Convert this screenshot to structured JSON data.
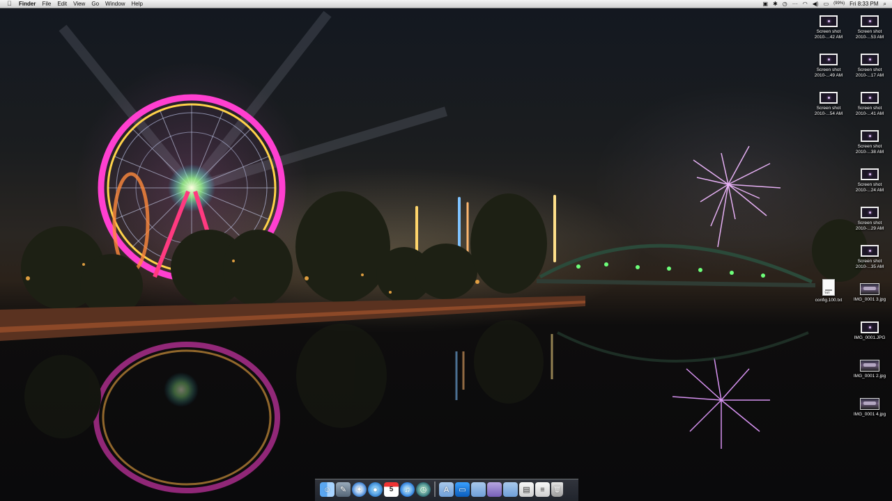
{
  "menubar": {
    "apple": "",
    "app_name": "Finder",
    "menus": [
      "File",
      "Edit",
      "View",
      "Go",
      "Window",
      "Help"
    ],
    "battery_percent": "(99%)",
    "clock": "Fri 8:33 PM",
    "icons": [
      "airplay-icon",
      "bluetooth-icon",
      "time-machine-icon",
      "dots-icon",
      "wifi-icon",
      "volume-icon",
      "battery-icon",
      "spotlight-icon"
    ]
  },
  "desktop": {
    "right_column": [
      {
        "label": "Screen shot",
        "sub": "2010-...53 AM",
        "type": "screenshot"
      },
      {
        "label": "Screen shot",
        "sub": "2010-...17 AM",
        "type": "screenshot"
      },
      {
        "label": "Screen shot",
        "sub": "2010-...41 AM",
        "type": "screenshot"
      },
      {
        "label": "Screen shot",
        "sub": "2010-...38 AM",
        "type": "screenshot"
      },
      {
        "label": "Screen shot",
        "sub": "2010-...24 AM",
        "type": "screenshot"
      },
      {
        "label": "Screen shot",
        "sub": "2010-...29 AM",
        "type": "screenshot"
      },
      {
        "label": "Screen shot",
        "sub": "2010-...35 AM",
        "type": "screenshot"
      },
      {
        "label": "IMG_0001 3.jpg",
        "sub": "",
        "type": "photo"
      },
      {
        "label": "IMG_0001.JPG",
        "sub": "",
        "type": "screenshot"
      },
      {
        "label": "IMG_0001 2.jpg",
        "sub": "",
        "type": "photo"
      },
      {
        "label": "IMG_0001 4.jpg",
        "sub": "",
        "type": "photo"
      }
    ],
    "left_column": [
      {
        "label": "Screen shot",
        "sub": "2010-...42 AM",
        "type": "screenshot"
      },
      {
        "label": "Screen shot",
        "sub": "2010-...49 AM",
        "type": "screenshot"
      },
      {
        "label": "Screen shot",
        "sub": "2010-...54 AM",
        "type": "screenshot"
      },
      {
        "label": "config.100.txt",
        "sub": "",
        "type": "doc",
        "badge": "TXT"
      }
    ]
  },
  "dock": {
    "items": [
      {
        "name": "finder",
        "glyph": "☺"
      },
      {
        "name": "preview",
        "glyph": "✎"
      },
      {
        "name": "safari",
        "glyph": "✦"
      },
      {
        "name": "facetime",
        "glyph": "●"
      },
      {
        "name": "ical",
        "glyph": "5"
      },
      {
        "name": "itunes",
        "glyph": "♫"
      },
      {
        "name": "time-machine",
        "glyph": "◷"
      },
      {
        "name": "applications-folder",
        "glyph": "A"
      },
      {
        "name": "screen-sharing",
        "glyph": "▭"
      },
      {
        "name": "documents-folder",
        "glyph": ""
      },
      {
        "name": "photo-folder",
        "glyph": ""
      },
      {
        "name": "downloads-folder",
        "glyph": ""
      },
      {
        "name": "terminal-window",
        "glyph": "▤"
      },
      {
        "name": "document",
        "glyph": "≡"
      },
      {
        "name": "trash",
        "glyph": "🗑"
      }
    ]
  },
  "colors": {
    "ferris_wheel": "#ff3fd0",
    "ferris_inner": "#ffd24a",
    "fireworks": "#f0b8ff",
    "bridge_lights": "#6dff7a"
  }
}
